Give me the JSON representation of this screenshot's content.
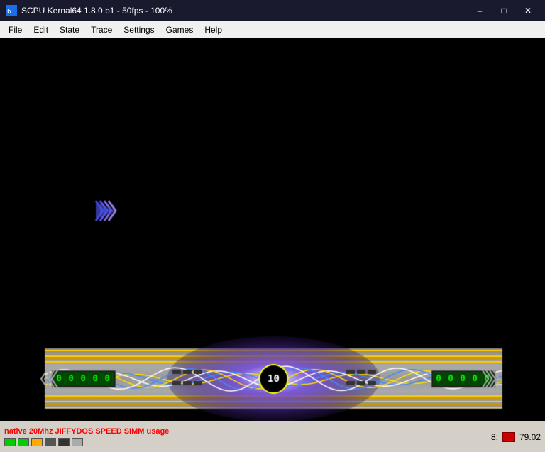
{
  "titlebar": {
    "title": "SCPU Kernal64 1.8.0 b1 - 50fps - 100%",
    "minimize_label": "–",
    "maximize_label": "□",
    "close_label": "✕"
  },
  "menubar": {
    "items": [
      "File",
      "Edit",
      "State",
      "Trace",
      "Settings",
      "Games",
      "Help"
    ]
  },
  "statusbar": {
    "text": "native 20Mhz JIFFYDOS SPEED SIMM usage",
    "right_label": "8:",
    "value": "79.02",
    "dots": [
      "green",
      "green",
      "orange",
      "gray",
      "darkgray",
      "lightgray"
    ]
  }
}
